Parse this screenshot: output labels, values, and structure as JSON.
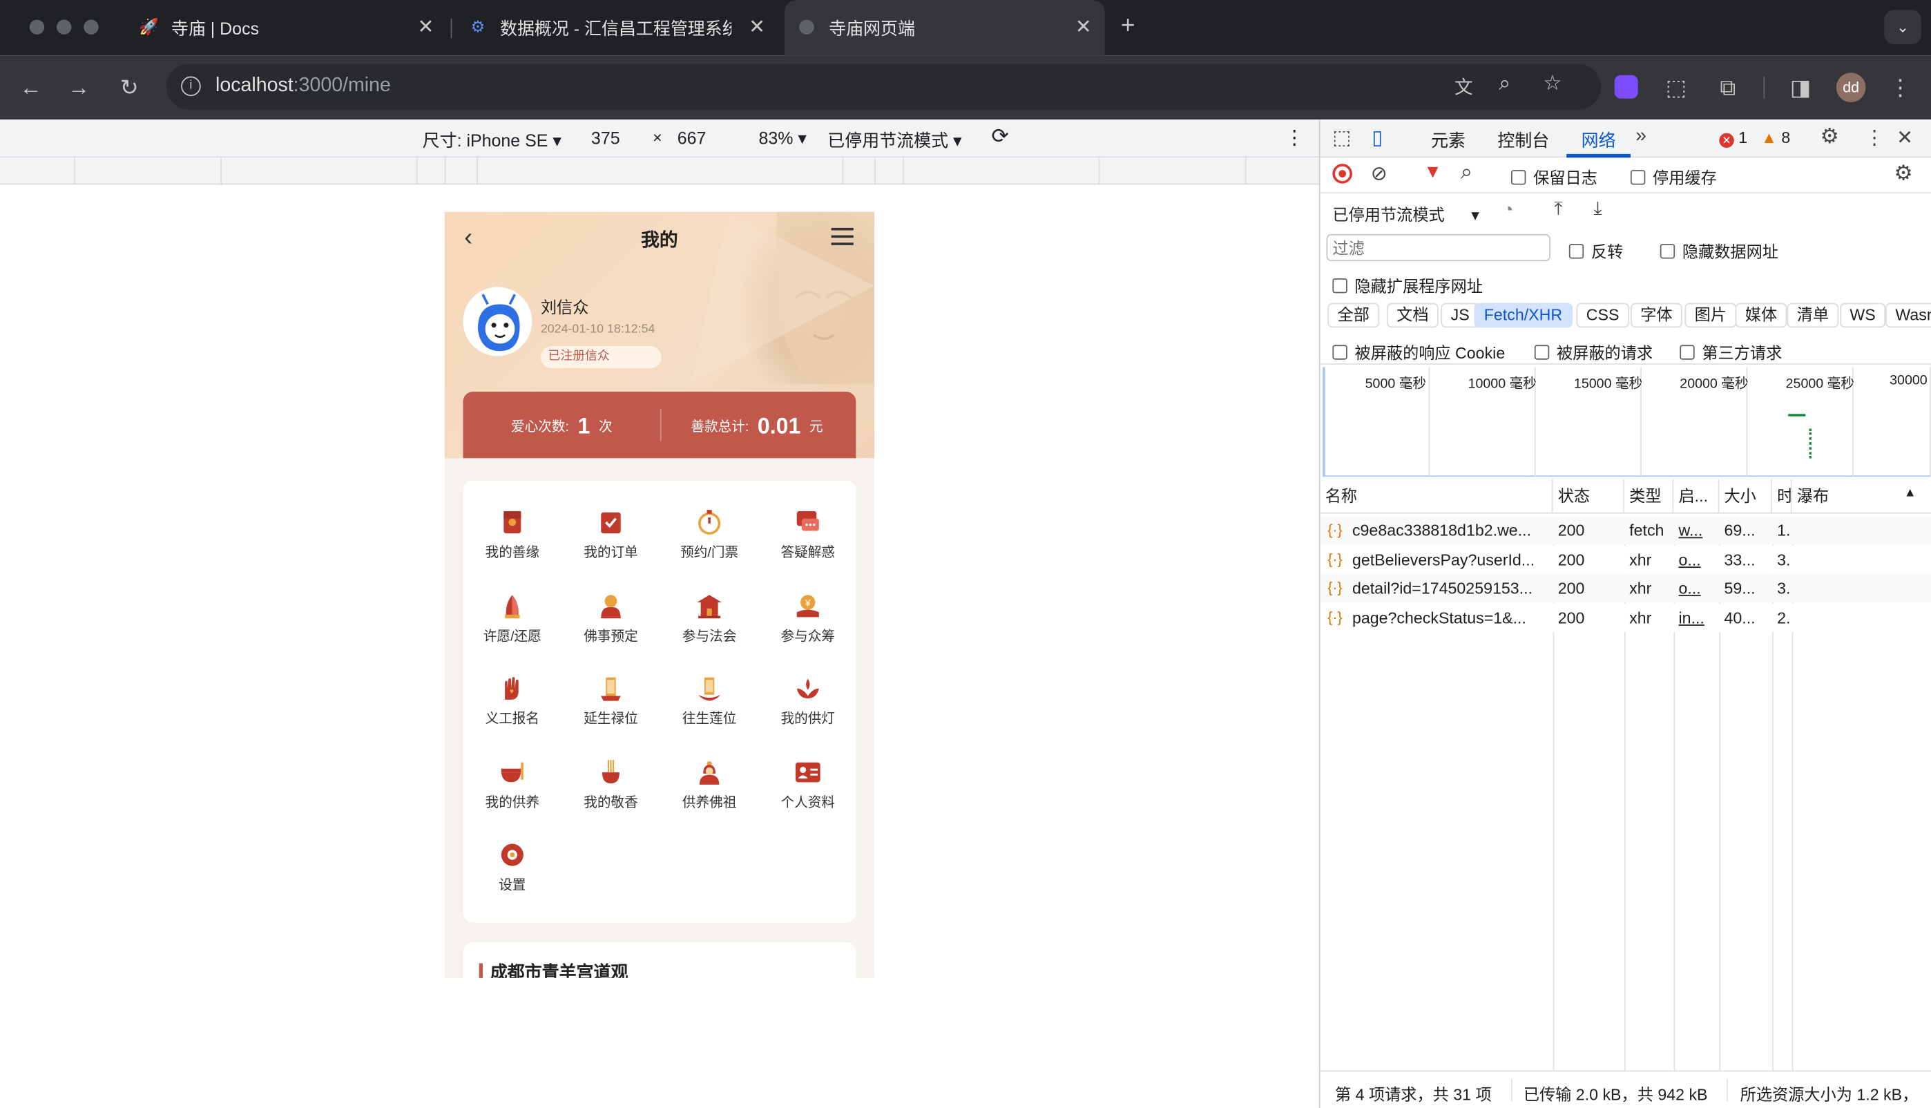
{
  "browser": {
    "tabs": [
      {
        "title": "寺庙 | Docs",
        "favicon": "rocket-icon"
      },
      {
        "title": "数据概况 - 汇信昌工程管理系统",
        "favicon": "app-logo-icon"
      },
      {
        "title": "寺庙网页端",
        "favicon": "globe-icon"
      }
    ],
    "url_host": "localhost",
    "url_path": ":3000/mine",
    "profile_initials": "dd"
  },
  "device_toolbar": {
    "device": "尺寸: iPhone SE",
    "width": "375",
    "times": "×",
    "height": "667",
    "zoom": "83%",
    "throttle": "已停用节流模式"
  },
  "page": {
    "title": "我的",
    "user": {
      "name": "刘信众",
      "date": "2024-01-10 18:12:54",
      "badge": "已注册信众"
    },
    "stats": [
      {
        "label": "爱心次数:",
        "value": "1",
        "unit": "次"
      },
      {
        "label": "善款总计:",
        "value": "0.01",
        "unit": "元"
      }
    ],
    "grid": [
      {
        "label": "我的善缘",
        "icon": "red-envelope-icon"
      },
      {
        "label": "我的订单",
        "icon": "order-icon"
      },
      {
        "label": "预约/门票",
        "icon": "timer-icon"
      },
      {
        "label": "答疑解惑",
        "icon": "chat-icon"
      },
      {
        "label": "许愿/还愿",
        "icon": "praying-hands-icon"
      },
      {
        "label": "佛事预定",
        "icon": "monk-icon"
      },
      {
        "label": "参与法会",
        "icon": "temple-icon"
      },
      {
        "label": "参与众筹",
        "icon": "coin-hand-icon"
      },
      {
        "label": "义工报名",
        "icon": "hand-heart-icon"
      },
      {
        "label": "延生禄位",
        "icon": "tablet-icon"
      },
      {
        "label": "往生莲位",
        "icon": "lotus-tablet-icon"
      },
      {
        "label": "我的供灯",
        "icon": "lotus-lamp-icon"
      },
      {
        "label": "我的供养",
        "icon": "bowl-icon"
      },
      {
        "label": "我的敬香",
        "icon": "incense-icon"
      },
      {
        "label": "供养佛祖",
        "icon": "buddha-icon"
      },
      {
        "label": "个人资料",
        "icon": "id-card-icon"
      },
      {
        "label": "设置",
        "icon": "gear-icon"
      }
    ],
    "temple_name": "成都市青羊宫道观"
  },
  "devtools": {
    "tabs": [
      "元素",
      "控制台",
      "网络"
    ],
    "errors": "1",
    "warnings": "8",
    "preserve_log": "保留日志",
    "disable_cache": "停用缓存",
    "throttle": "已停用节流模式",
    "filter_placeholder": "过滤",
    "invert": "反转",
    "hide_data_urls": "隐藏数据网址",
    "hide_ext_urls": "隐藏扩展程序网址",
    "type_filters": [
      "全部",
      "文档",
      "JS",
      "Fetch/XHR",
      "CSS",
      "字体",
      "图片",
      "媒体",
      "清单",
      "WS",
      "Wasm"
    ],
    "blocked_cookies": "被屏蔽的响应 Cookie",
    "blocked_requests": "被屏蔽的请求",
    "third_party": "第三方请求",
    "timeline_ticks": [
      "5000 毫秒",
      "10000 毫秒",
      "15000 毫秒",
      "20000 毫秒",
      "25000 毫秒",
      "30000"
    ],
    "columns": [
      "名称",
      "状态",
      "类型",
      "启...",
      "大小",
      "时",
      "瀑布"
    ],
    "rows": [
      {
        "name": "c9e8ac338818d1b2.we...",
        "status": "200",
        "type": "fetch",
        "initiator": "w...",
        "size": "69...",
        "time": "1."
      },
      {
        "name": "getBelieversPay?userId...",
        "status": "200",
        "type": "xhr",
        "initiator": "o...",
        "size": "33...",
        "time": "3."
      },
      {
        "name": "detail?id=17450259153...",
        "status": "200",
        "type": "xhr",
        "initiator": "o...",
        "size": "59...",
        "time": "3."
      },
      {
        "name": "page?checkStatus=1&...",
        "status": "200",
        "type": "xhr",
        "initiator": "in...",
        "size": "40...",
        "time": "2."
      }
    ],
    "footer": {
      "requests": "第 4 项请求，共 31 项",
      "transferred": "已传输 2.0 kB，共 942 kB",
      "resources": "所选资源大小为 1.2 kB，"
    }
  }
}
